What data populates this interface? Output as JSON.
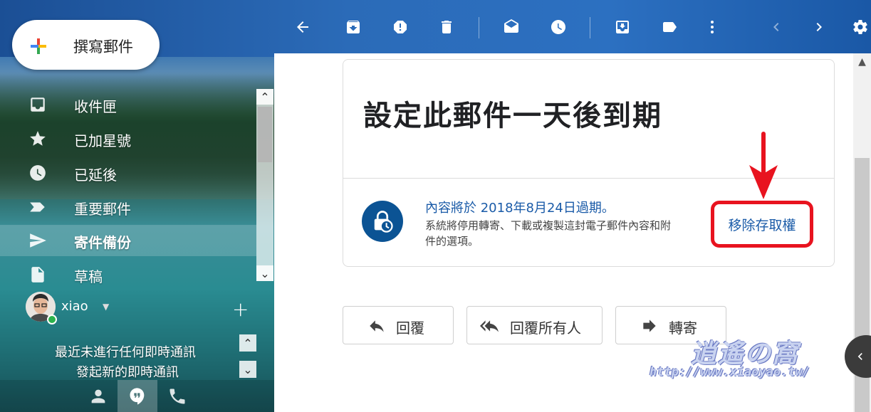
{
  "compose": {
    "label": "撰寫郵件"
  },
  "sidebar": {
    "items": [
      {
        "label": "收件匣",
        "icon": "inbox-icon"
      },
      {
        "label": "已加星號",
        "icon": "star-icon"
      },
      {
        "label": "已延後",
        "icon": "clock-icon"
      },
      {
        "label": "重要郵件",
        "icon": "important-icon"
      },
      {
        "label": "寄件備份",
        "icon": "send-icon",
        "active": true
      },
      {
        "label": "草稿",
        "icon": "draft-icon"
      }
    ]
  },
  "hangouts": {
    "user_name": "xiao",
    "status_line1": "最近未進行任何即時通訊",
    "status_line2": "發起新的即時通訊"
  },
  "toolbar": {
    "icons": [
      "back-arrow-icon",
      "archive-icon",
      "report-spam-icon",
      "delete-icon",
      "mark-unread-icon",
      "snooze-icon",
      "move-to-icon",
      "label-icon",
      "more-icon",
      "prev-icon",
      "next-icon",
      "settings-icon"
    ]
  },
  "message": {
    "title": "設定此郵件一天後到期",
    "expiry_line1": "內容將於 2018年8月24日過期。",
    "expiry_line2": "系統將停用轉寄、下載或複製這封電子郵件內容和附件的選項。",
    "remove_access_label": "移除存取權",
    "reply_label": "回覆",
    "reply_all_label": "回覆所有人",
    "forward_label": "轉寄"
  },
  "watermark": {
    "brand": "逍遙の窩",
    "url": "http://www.xiaoyao.tw/"
  },
  "colors": {
    "link_blue": "#1a5ba8",
    "annotation_red": "#e8131f",
    "expiry_icon_bg": "#0b5394"
  }
}
